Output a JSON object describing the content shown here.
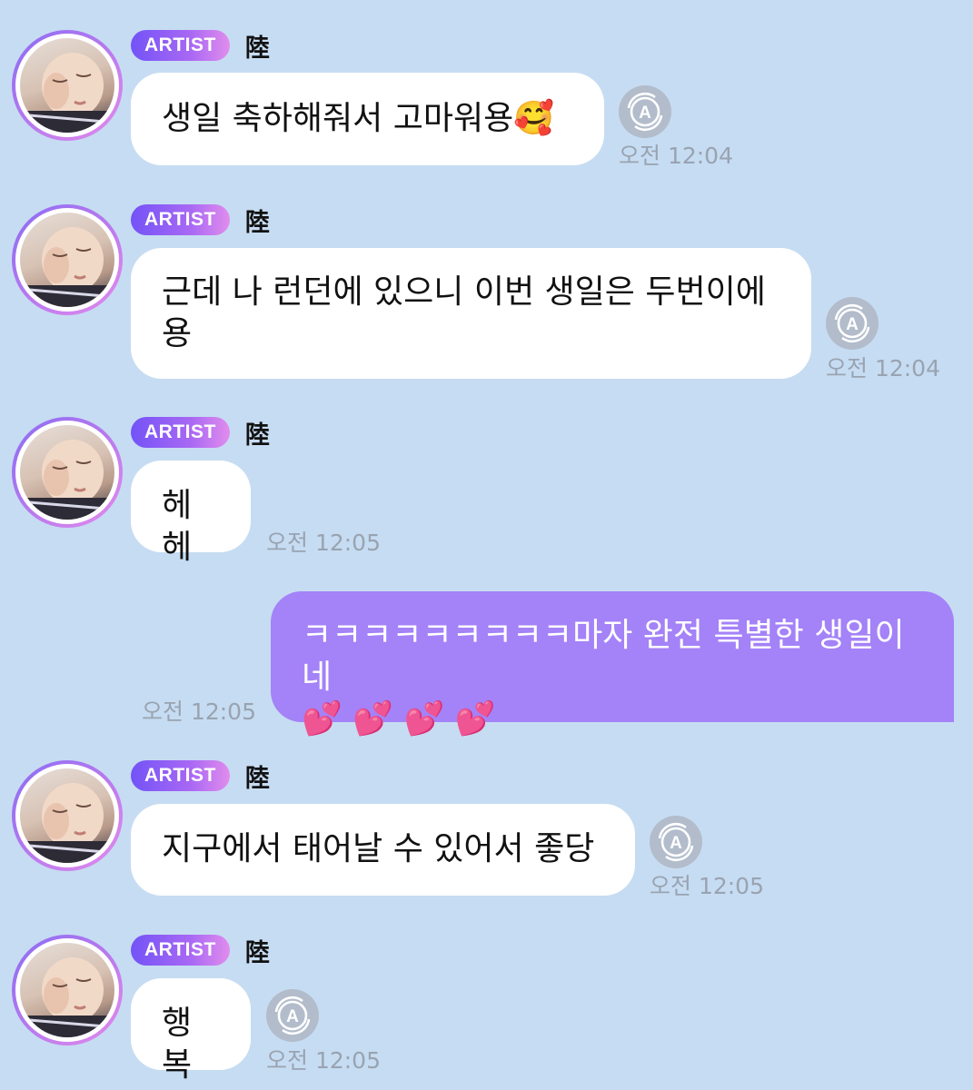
{
  "sender": {
    "badge": "ARTIST",
    "name": "陸"
  },
  "translate_icon_letter": "A",
  "messages": [
    {
      "from": "artist",
      "text": "생일 축하해줘서 고마워용🥰",
      "time": "오전 12:04"
    },
    {
      "from": "artist",
      "text": "근데 나 런던에 있으니 이번 생일은 두번이에\n용",
      "time": "오전 12:04"
    },
    {
      "from": "artist",
      "text": "헤헤",
      "time": "오전 12:05"
    },
    {
      "from": "me",
      "text": "ㅋㅋㅋㅋㅋㅋㅋㅋㅋ마자 완전 특별한 생일이네\n💕 💕 💕 💕",
      "time": "오전 12:05"
    },
    {
      "from": "artist",
      "text": "지구에서 태어날 수 있어서 좋당",
      "time": "오전 12:05"
    },
    {
      "from": "artist",
      "text": "행복",
      "time": "오전 12:05"
    }
  ]
}
